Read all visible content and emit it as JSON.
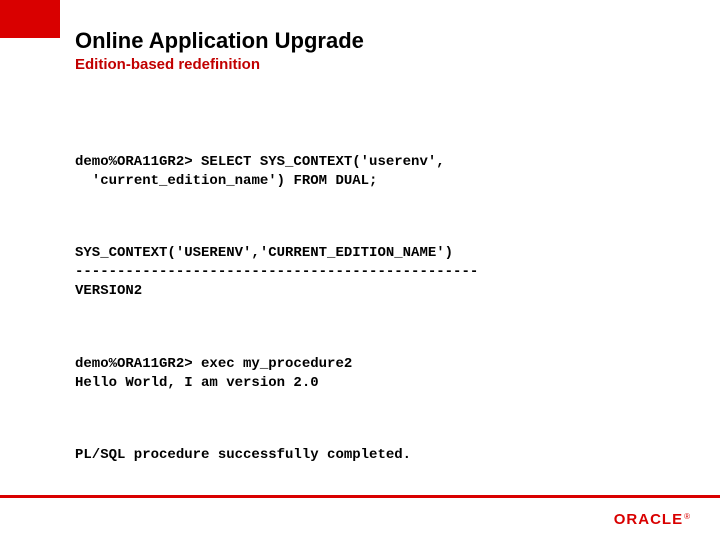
{
  "header": {
    "title": "Online Application Upgrade",
    "subtitle": "Edition-based redefinition"
  },
  "code": {
    "block1": "demo%ORA11GR2> SELECT SYS_CONTEXT('userenv',\n  'current_edition_name') FROM DUAL;",
    "block2": "SYS_CONTEXT('USERENV','CURRENT_EDITION_NAME')\n------------------------------------------------\nVERSION2",
    "block3": "demo%ORA11GR2> exec my_procedure2\nHello World, I am version 2.0",
    "block4": "PL/SQL procedure successfully completed."
  },
  "footer": {
    "logo_text": "ORACLE",
    "reg": "®"
  },
  "colors": {
    "accent": "#d90000"
  }
}
